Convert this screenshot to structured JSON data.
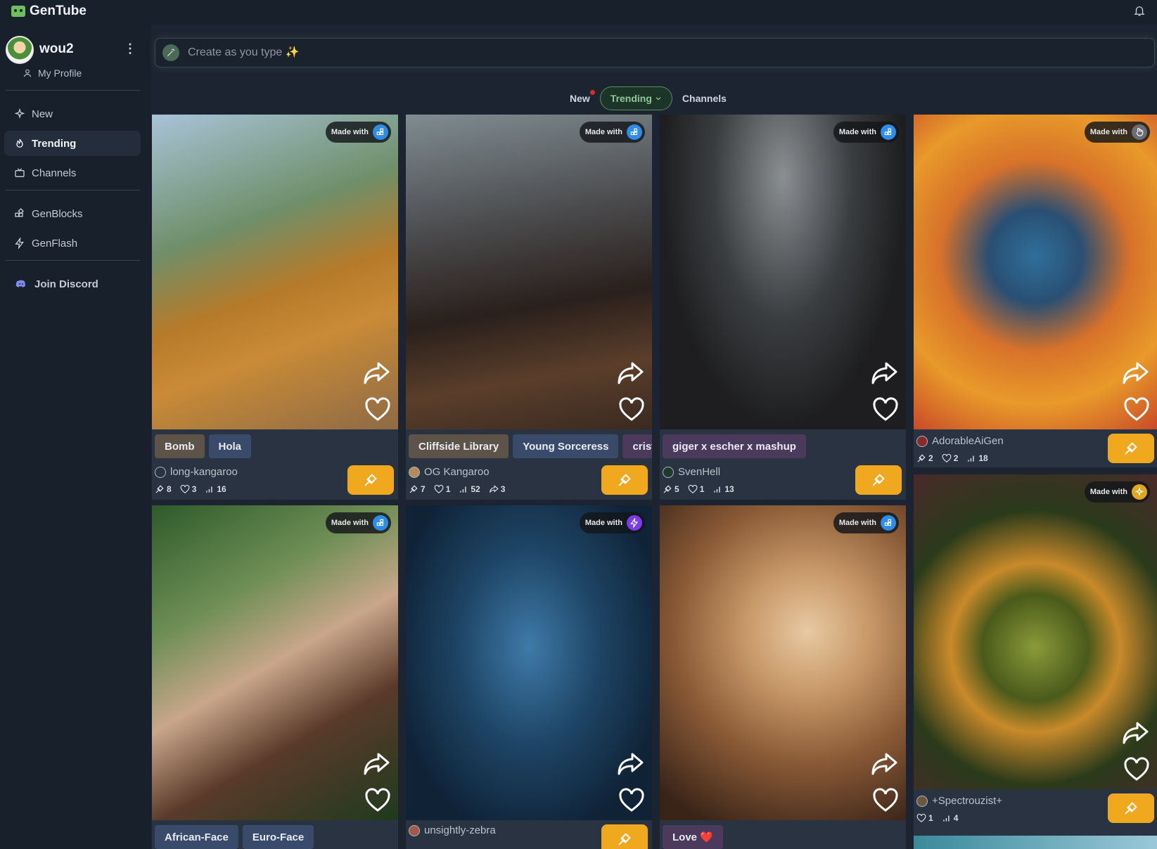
{
  "app": {
    "title": "GenTube"
  },
  "user": {
    "name": "wou2",
    "profile_label": "My Profile"
  },
  "nav": [
    {
      "id": "new",
      "label": "New",
      "active": false
    },
    {
      "id": "trending",
      "label": "Trending",
      "active": true
    },
    {
      "id": "channels",
      "label": "Channels",
      "active": false
    },
    {
      "id": "genblocks",
      "label": "GenBlocks",
      "active": false
    },
    {
      "id": "genflash",
      "label": "GenFlash",
      "active": false
    }
  ],
  "discord": {
    "label": "Join Discord"
  },
  "search": {
    "placeholder": "Create as you type ✨"
  },
  "tabs": {
    "new": "New",
    "trending": "Trending",
    "channels": "Channels"
  },
  "made_with_label": "Made with",
  "colors": {
    "accent_remix": "#f0a81e",
    "trending_green": "#8fc89a",
    "new_dot": "#e02a2a"
  },
  "cards": [
    {
      "tags": [
        "Bomb",
        "Hola"
      ],
      "author": "long-kangaroo",
      "stats": {
        "remixes": "8",
        "likes": "3",
        "views": "16"
      },
      "made_icon": "blocks-icon"
    },
    {
      "tags": [
        "Cliffside Library",
        "Young Sorceress",
        "crista"
      ],
      "author": "OG Kangaroo",
      "stats": {
        "remixes": "7",
        "likes": "1",
        "views": "52",
        "shares": "3"
      },
      "made_icon": "blocks-icon"
    },
    {
      "tags": [
        "giger x escher x mashup"
      ],
      "author": "SvenHell",
      "stats": {
        "remixes": "5",
        "likes": "1",
        "views": "13"
      },
      "made_icon": "blocks-icon"
    },
    {
      "tags": [],
      "author": "AdorableAiGen",
      "stats": {
        "remixes": "2",
        "likes": "2",
        "views": "18"
      },
      "made_icon": "hand-icon"
    },
    {
      "tags": [
        "African-Face",
        "Euro-Face"
      ],
      "author": "",
      "stats": {},
      "made_icon": "blocks-icon"
    },
    {
      "tags": [],
      "author": "unsightly-zebra",
      "stats": {},
      "made_icon": "flash-icon"
    },
    {
      "tags": [
        "Love ❤️"
      ],
      "author": "",
      "stats": {},
      "made_icon": "blocks-icon"
    },
    {
      "tags": [],
      "author": "+Spectrouzist+",
      "stats": {
        "likes": "1",
        "views": "4"
      },
      "made_icon": "sparkle-icon"
    }
  ]
}
